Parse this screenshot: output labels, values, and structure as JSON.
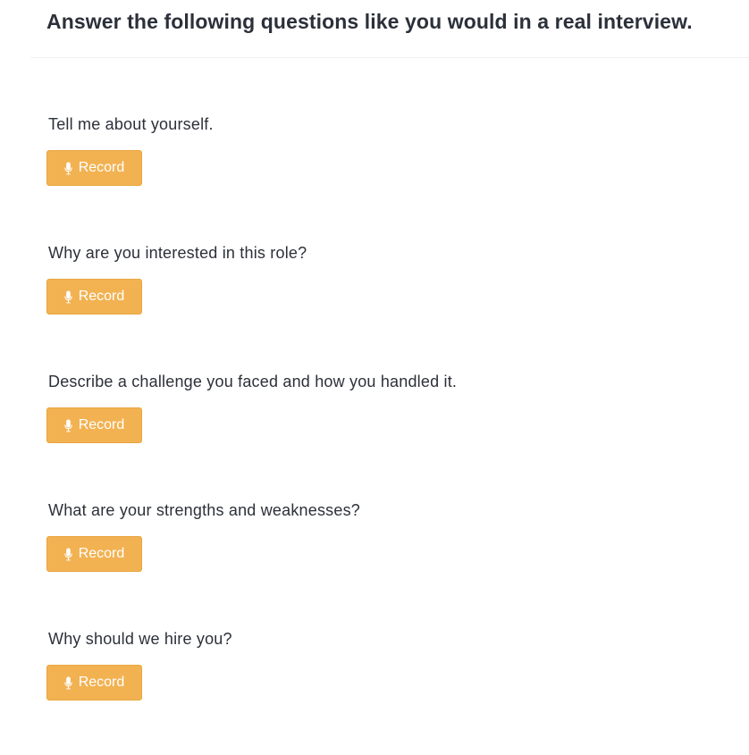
{
  "page": {
    "title": "Answer the following questions like you would in a real interview."
  },
  "questions": [
    {
      "text": "Tell me about yourself.",
      "button_label": "Record",
      "button_icon": "microphone-icon"
    },
    {
      "text": "Why are you interested in this role?",
      "button_label": "Record",
      "button_icon": "microphone-icon"
    },
    {
      "text": "Describe a challenge you faced and how you handled it.",
      "button_label": "Record",
      "button_icon": "microphone-icon"
    },
    {
      "text": "What are your strengths and weaknesses?",
      "button_label": "Record",
      "button_icon": "microphone-icon"
    },
    {
      "text": "Why should we hire you?",
      "button_label": "Record",
      "button_icon": "microphone-icon"
    }
  ],
  "colors": {
    "button_background": "#f2b252",
    "button_text": "#ffffff",
    "title_text": "#2b303a"
  }
}
